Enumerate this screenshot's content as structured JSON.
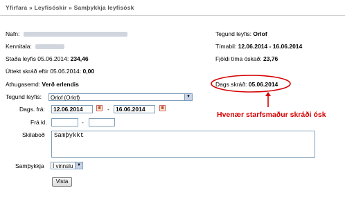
{
  "breadcrumb": {
    "item1": "Yfirfara",
    "sep": "»",
    "item2": "Leyfisóskir",
    "item3": "Samþykkja leyfisósk"
  },
  "info": {
    "name_label": "Nafn:",
    "kennitala_label": "Kennitala:",
    "balance_label": "Staða leyfis 05.06.2014:",
    "balance_value": "234,46",
    "withdrawn_label": "Úttekt skráð eftir 05.06.2014:",
    "withdrawn_value": "0,00",
    "note_label": "Athugasemd:",
    "note_value": "Verð erlendis",
    "type_label": "Tegund leyfis:",
    "type_value": "Orlof",
    "period_label": "Tímabil:",
    "period_value": "12.06.2014 - 16.06.2014",
    "hours_label": "Fjöldi tíma óskað:",
    "hours_value": "23,76",
    "registered_label": "Dags skráð:",
    "registered_value": "05.06.2014"
  },
  "form": {
    "type_label": "Tegund leyfis:",
    "type_select": "Orlof (Orlof)",
    "date_from_label": "Dags. frá:",
    "date_from": "12.06.2014",
    "date_dash": "-",
    "date_to": "16.06.2014",
    "time_from_label": "Frá kl.",
    "time_dash": "-",
    "message_label": "Skilaboð",
    "message_value": "Samþykkt",
    "approve_label": "Samþykkja",
    "approve_select": "Í vinnslu",
    "save_button": "Vista"
  },
  "annotation": {
    "text": "Hvenær starfsmaður skráði ósk"
  },
  "colors": {
    "annotation": "#d50000",
    "field_border": "#7f9db9"
  }
}
